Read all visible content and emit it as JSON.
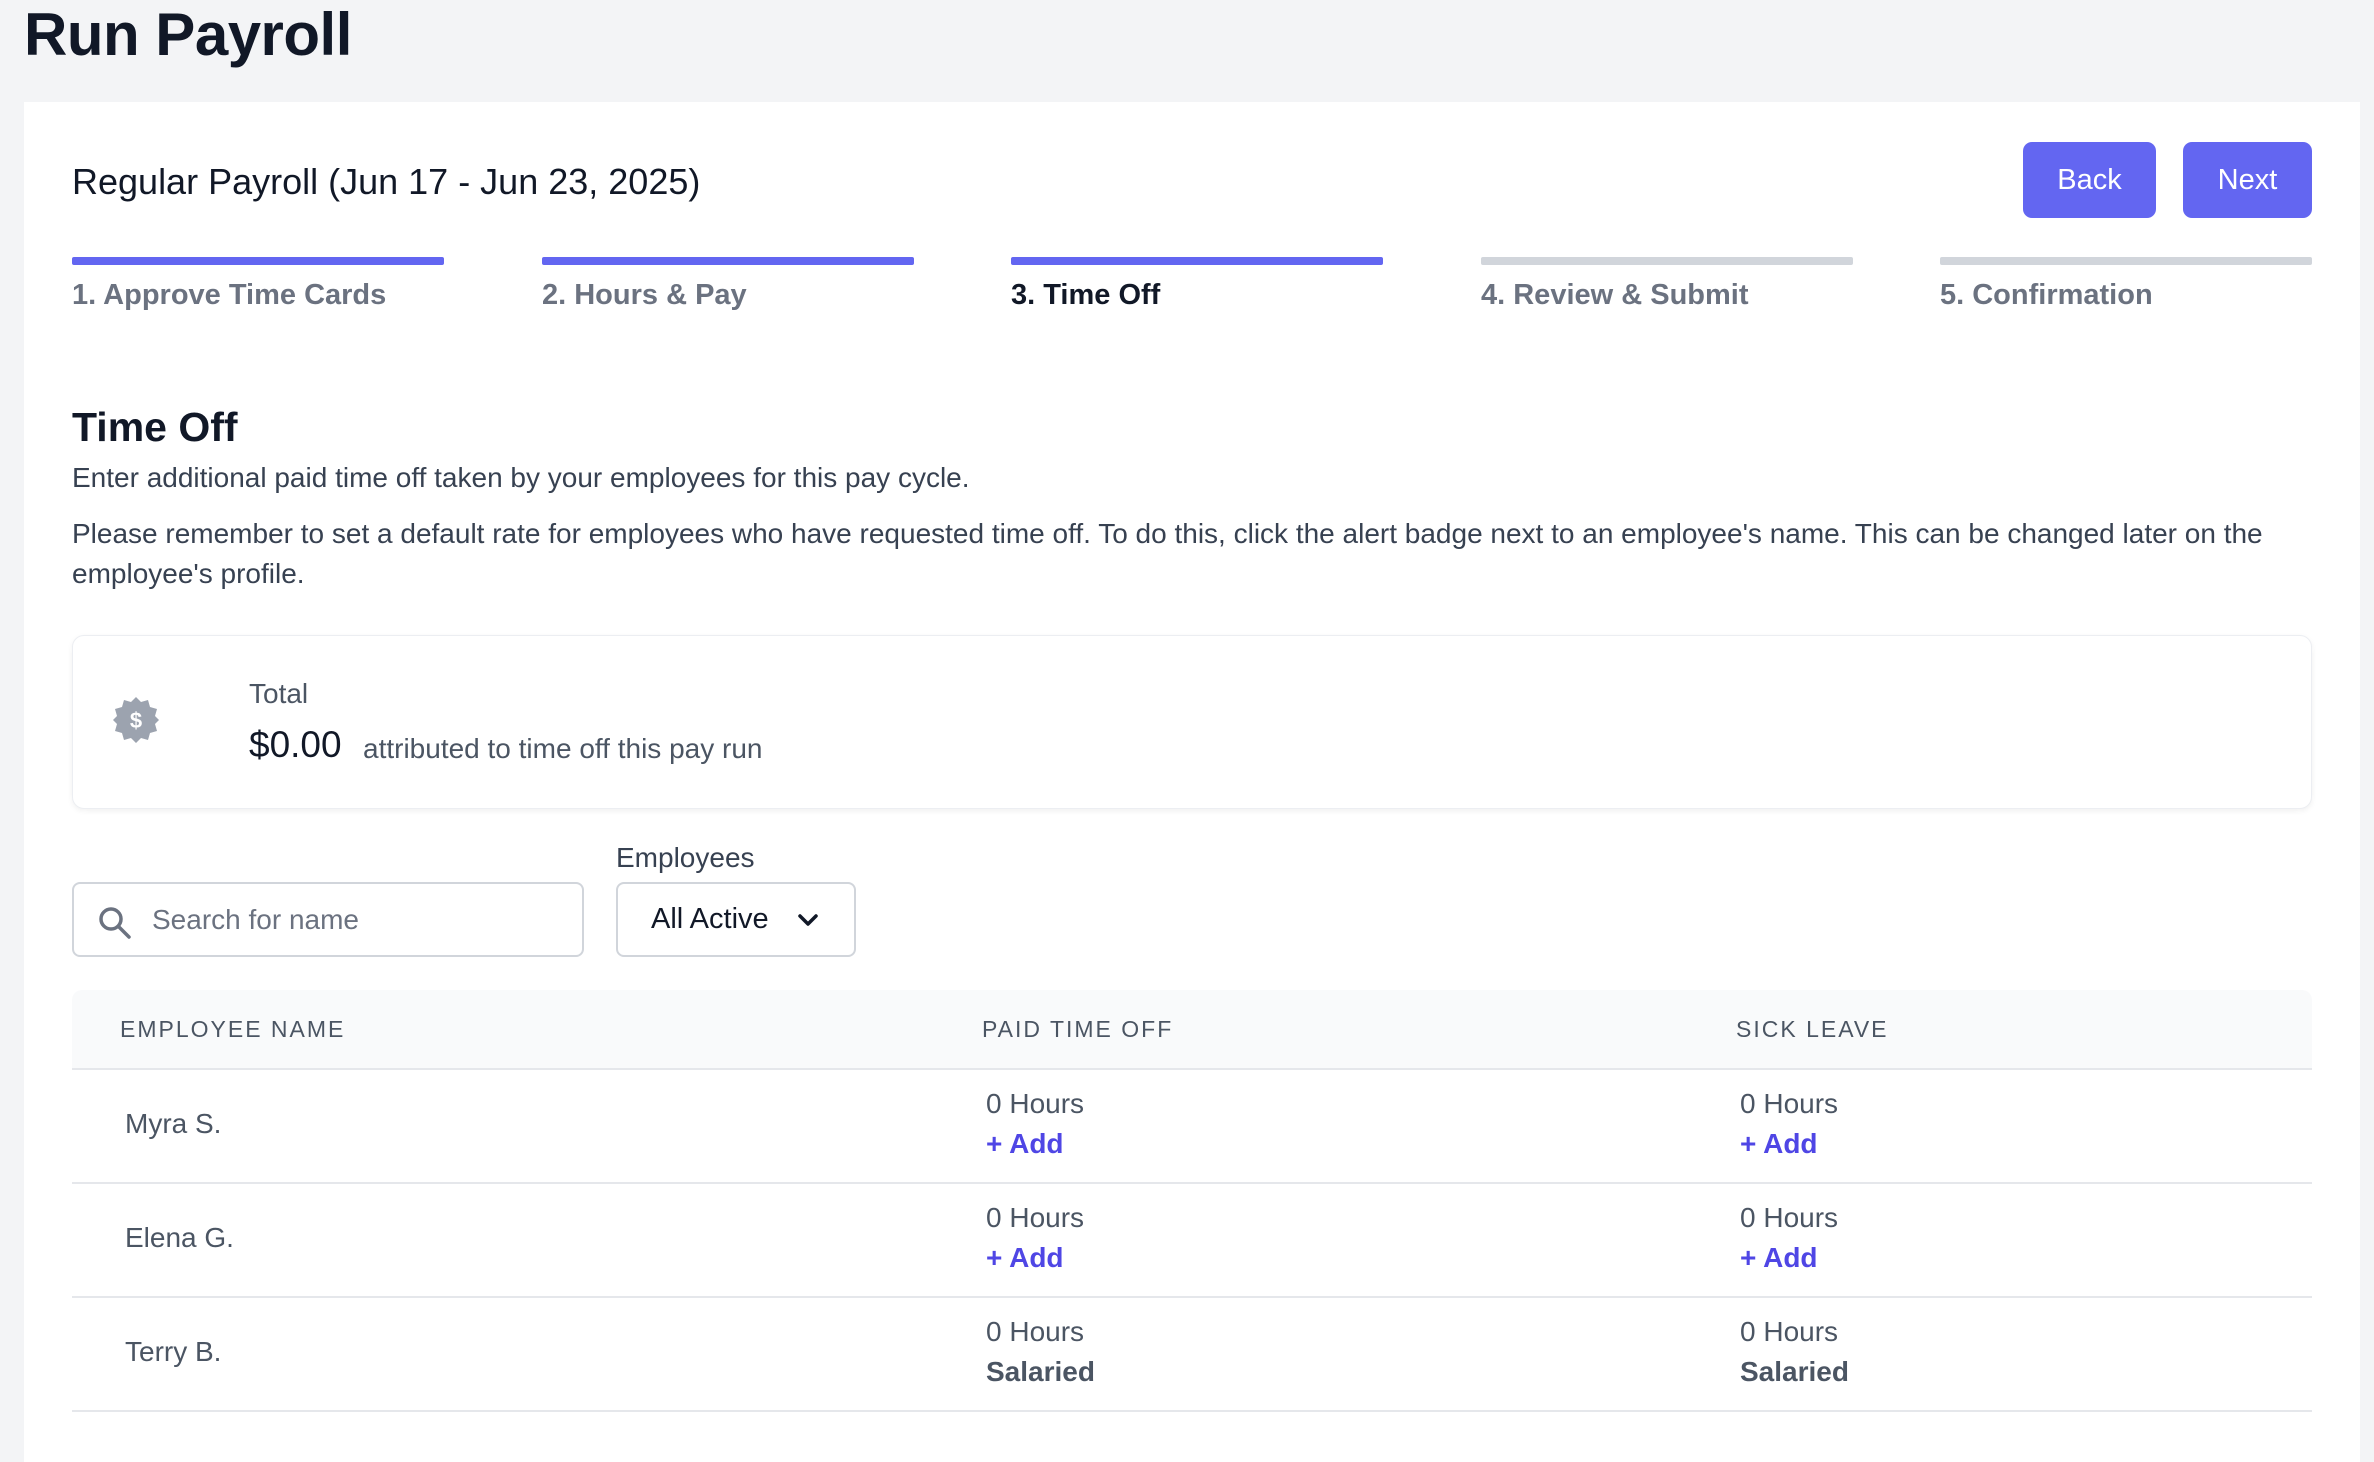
{
  "page": {
    "title": "Run Payroll"
  },
  "header": {
    "payroll_title": "Regular Payroll (Jun 17 - Jun 23, 2025)",
    "back_label": "Back",
    "next_label": "Next"
  },
  "steps": [
    {
      "label": "1. Approve Time Cards",
      "state": "done"
    },
    {
      "label": "2. Hours & Pay",
      "state": "done"
    },
    {
      "label": "3. Time Off",
      "state": "active"
    },
    {
      "label": "4. Review & Submit",
      "state": "pending"
    },
    {
      "label": "5. Confirmation",
      "state": "pending"
    }
  ],
  "section": {
    "title": "Time Off",
    "description": "Enter additional paid time off taken by your employees for this pay cycle.",
    "reminder": "Please remember to set a default rate for employees who have requested time off. To do this, click the alert badge next to an employee's name. This can be changed later on the employee's profile."
  },
  "total": {
    "label": "Total",
    "amount": "$0.00",
    "suffix": "attributed to time off this pay run",
    "icon": "dollar-badge-icon"
  },
  "filters": {
    "search_placeholder": "Search for name",
    "search_value": "",
    "employees_label": "Employees",
    "employees_selected": "All Active"
  },
  "table": {
    "headers": [
      "EMPLOYEE NAME",
      "PAID TIME OFF",
      "SICK LEAVE"
    ],
    "rows": [
      {
        "name": "Myra S.",
        "pto_hours": "0 Hours",
        "pto_action": "+ Add",
        "sick_hours": "0 Hours",
        "sick_action": "+ Add"
      },
      {
        "name": "Elena G.",
        "pto_hours": "0 Hours",
        "pto_action": "+ Add",
        "sick_hours": "0 Hours",
        "sick_action": "+ Add"
      },
      {
        "name": "Terry B.",
        "pto_hours": "0 Hours",
        "pto_action": "Salaried",
        "sick_hours": "0 Hours",
        "sick_action": "Salaried"
      }
    ]
  },
  "colors": {
    "accent": "#6366f1",
    "link": "#4f46e5",
    "background": "#f3f4f6"
  }
}
